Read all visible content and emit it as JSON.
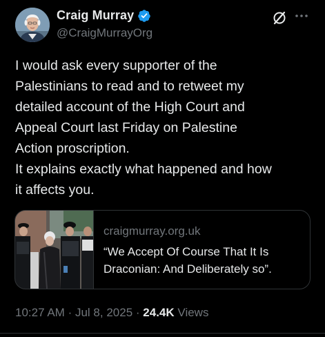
{
  "author": {
    "display_name": "Craig Murray",
    "handle": "@CraigMurrayOrg",
    "verified": true
  },
  "tweet": {
    "lines": [
      "I would ask every supporter of the",
      "Palestinians to read and to retweet my",
      "detailed account of the High Court and",
      "Appeal Court last Friday on Palestine",
      "Action proscription.",
      "It explains exactly what happened and how",
      "it affects you."
    ]
  },
  "link_card": {
    "domain": "craigmurray.org.uk",
    "title": "“We Accept Of Course That It Is Draconian: And Deliberately so”."
  },
  "meta": {
    "time": "10:27 AM",
    "separator": "·",
    "date": "Jul 8, 2025",
    "views_count": "24.4K",
    "views_label": "Views"
  },
  "icons": {
    "verified": "verified-badge-icon",
    "grok": "grok-icon",
    "more": "more-options-icon"
  },
  "colors": {
    "background": "#000000",
    "text_primary": "#e7e9ea",
    "text_secondary": "#71767b",
    "verified_blue": "#1d9bf0",
    "border": "#2f3336"
  }
}
